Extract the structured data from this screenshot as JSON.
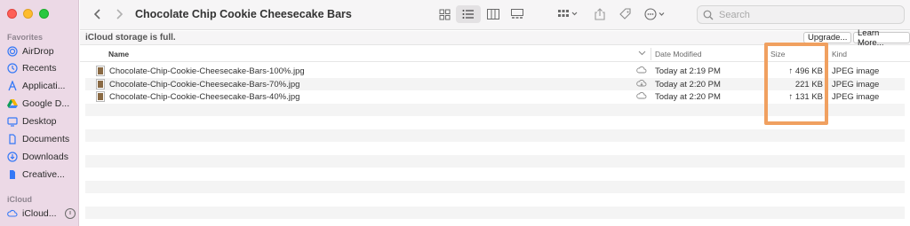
{
  "window": {
    "title": "Chocolate Chip Cookie Cheesecake Bars"
  },
  "sidebar": {
    "favorites_label": "Favorites",
    "icloud_label": "iCloud",
    "favorites": [
      {
        "label": "AirDrop",
        "icon": "airdrop-icon"
      },
      {
        "label": "Recents",
        "icon": "clock-icon"
      },
      {
        "label": "Applicati...",
        "icon": "applications-icon"
      },
      {
        "label": "Google D...",
        "icon": "google-drive-icon"
      },
      {
        "label": "Desktop",
        "icon": "desktop-icon"
      },
      {
        "label": "Documents",
        "icon": "document-icon"
      },
      {
        "label": "Downloads",
        "icon": "downloads-icon"
      },
      {
        "label": "Creative...",
        "icon": "document-icon"
      }
    ],
    "icloud": [
      {
        "label": "iCloud...",
        "icon": "icloud-drive-icon"
      }
    ]
  },
  "search": {
    "placeholder": "Search",
    "value": ""
  },
  "notice": {
    "text": "iCloud storage is full.",
    "upgrade_label": "Upgrade...",
    "learn_more_label": "Learn More..."
  },
  "columns": {
    "name": "Name",
    "date_modified": "Date Modified",
    "size": "Size",
    "kind": "Kind"
  },
  "files": [
    {
      "name": "Chocolate-Chip-Cookie-Cheesecake-Bars-100%.jpg",
      "date_modified": "Today at 2:19 PM",
      "size": "↑ 496 KB",
      "kind": "JPEG image"
    },
    {
      "name": "Chocolate-Chip-Cookie-Cheesecake-Bars-70%.jpg",
      "date_modified": "Today at 2:20 PM",
      "size": "221 KB",
      "kind": "JPEG image"
    },
    {
      "name": "Chocolate-Chip-Cookie-Cheesecake-Bars-40%.jpg",
      "date_modified": "Today at 2:20 PM",
      "size": "↑ 131 KB",
      "kind": "JPEG image"
    }
  ],
  "colors": {
    "sidebar_bg": "#ecd9e6",
    "accent_blue": "#3478f6",
    "highlight_orange": "#f0a060"
  }
}
